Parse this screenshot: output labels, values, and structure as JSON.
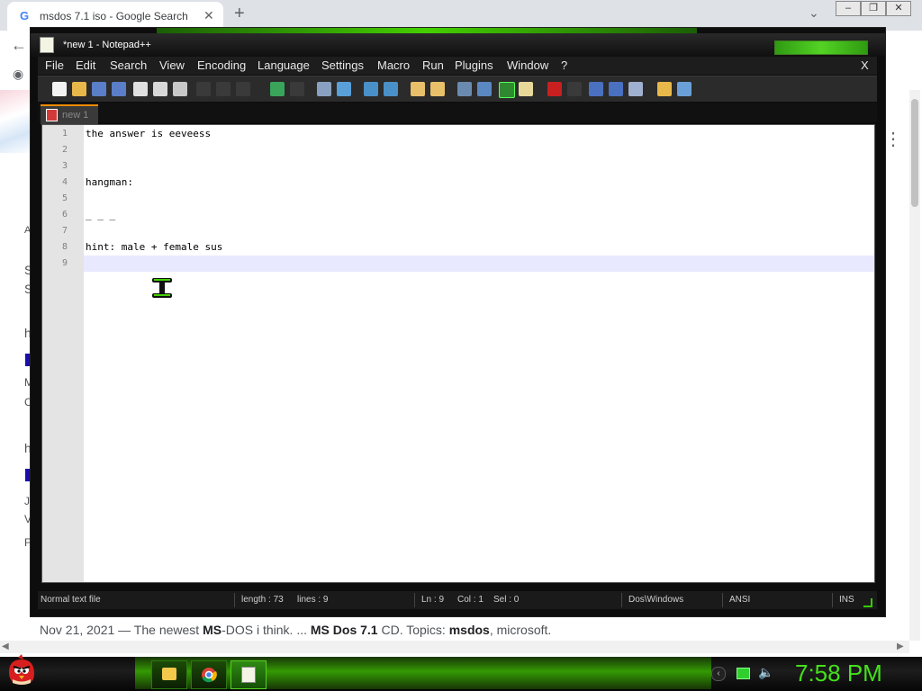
{
  "chrome": {
    "tab_title": "msdos 7.1 iso - Google Search",
    "tab_close": "✕",
    "new_tab": "+",
    "back_icon": "arrow-left-icon",
    "snippet": {
      "date": "Nov 21, 2021 — The newest ",
      "ms": "MS",
      "mid": "-DOS i think. ... ",
      "msdos71": "MS Dos 7.1",
      "topics": " CD. Topics: ",
      "t1": "msdos",
      "sep": ", microsoft."
    },
    "window_buttons": [
      "–",
      "❐",
      "✕"
    ]
  },
  "npp": {
    "title": "*new  1 - Notepad++",
    "close": "X",
    "menu": [
      "File",
      "Edit",
      "Search",
      "View",
      "Encoding",
      "Language",
      "Settings",
      "Macro",
      "Run",
      "Plugins",
      "Window",
      "?"
    ],
    "tab_label": "new  1",
    "lines": [
      {
        "n": "1",
        "text": "the answer is eeveess"
      },
      {
        "n": "2",
        "text": ""
      },
      {
        "n": "3",
        "text": ""
      },
      {
        "n": "4",
        "text": "hangman:"
      },
      {
        "n": "5",
        "text": ""
      },
      {
        "n": "6",
        "text": "_ _ _"
      },
      {
        "n": "7",
        "text": ""
      },
      {
        "n": "8",
        "text": "hint: male + female sus"
      },
      {
        "n": "9",
        "text": ""
      }
    ],
    "status": {
      "type": "Normal text file",
      "length": "length : 73",
      "lines": "lines : 9",
      "ln": "Ln : 9",
      "col": "Col : 1",
      "sel": "Sel : 0",
      "eol": "Dos\\Windows",
      "enc": "ANSI",
      "mode": "INS"
    },
    "colors": {
      "accent": "#44d000",
      "tab_accent": "#f08c00"
    }
  },
  "taskbar": {
    "clock": "7:58 PM",
    "icons": [
      "angry-bird-start-icon",
      "folder-icon",
      "chrome-icon",
      "notepad-icon",
      "chevron-icon",
      "network-icon",
      "speaker-icon"
    ]
  }
}
